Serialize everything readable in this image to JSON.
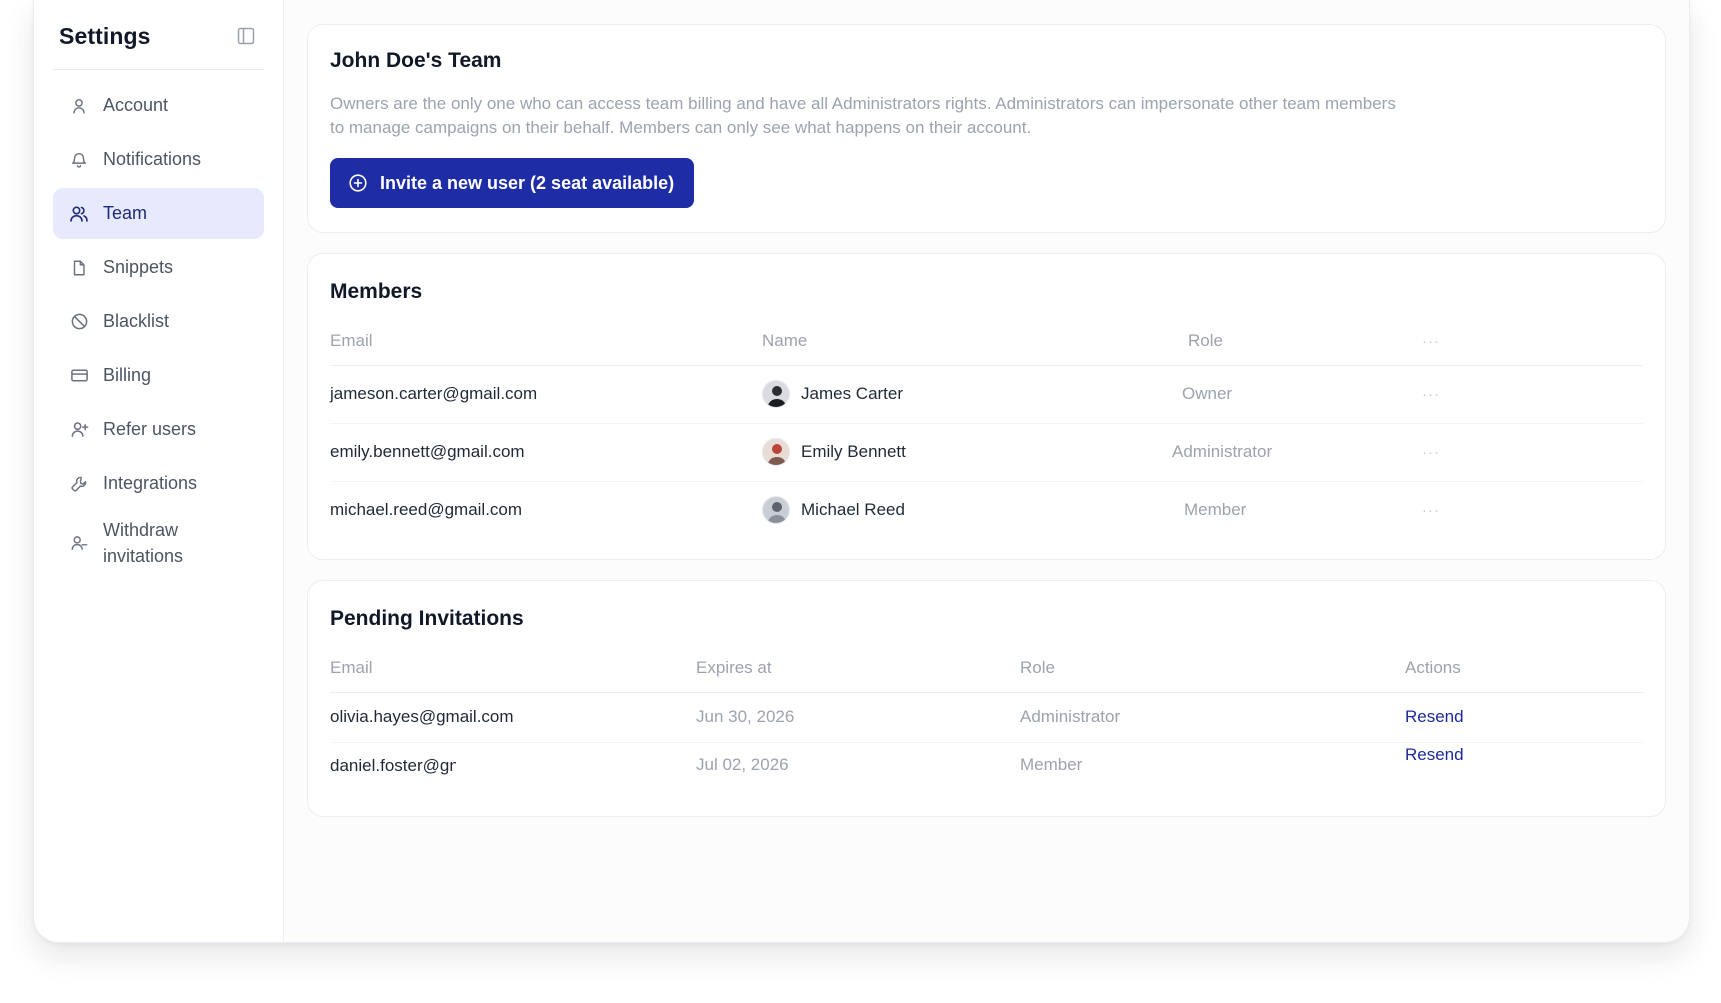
{
  "sidebar": {
    "title": "Settings",
    "items": [
      {
        "label": "Account",
        "icon": "user-icon"
      },
      {
        "label": "Notifications",
        "icon": "bell-icon"
      },
      {
        "label": "Team",
        "icon": "users-icon",
        "active": true
      },
      {
        "label": "Snippets",
        "icon": "file-icon"
      },
      {
        "label": "Blacklist",
        "icon": "ban-icon"
      },
      {
        "label": "Billing",
        "icon": "credit-card-icon"
      },
      {
        "label": "Refer users",
        "icon": "user-plus-icon"
      },
      {
        "label": "Integrations",
        "icon": "wrench-icon"
      },
      {
        "label": "Withdraw invitations",
        "icon": "user-minus-icon"
      }
    ]
  },
  "team": {
    "title": "John Doe's Team",
    "description": "Owners are the only one who can access team billing and have all Administrators rights. Administrators can impersonate other team members to manage campaigns on their behalf. Members can only see what happens on their account.",
    "invite_label": "Invite a new user (2 seat available)"
  },
  "members": {
    "title": "Members",
    "columns": {
      "email": "Email",
      "name": "Name",
      "role": "Role",
      "actions": "···"
    },
    "rows": [
      {
        "email": "jameson.carter@gmail.com",
        "name": "James Carter",
        "role": "Owner",
        "actions": "···"
      },
      {
        "email": "emily.bennett@gmail.com",
        "name": "Emily Bennett",
        "role": "Administrator",
        "actions": "···"
      },
      {
        "email": "michael.reed@gmail.com",
        "name": "Michael Reed",
        "role": "Member",
        "actions": "···"
      }
    ]
  },
  "pending": {
    "title": "Pending Invitations",
    "columns": {
      "email": "Email",
      "expires": "Expires at",
      "role": "Role",
      "actions": "Actions"
    },
    "rows": [
      {
        "email": "olivia.hayes@gmail.com",
        "expires": "Jun 30, 2026",
        "role": "Administrator",
        "action": "Resend"
      },
      {
        "email": "daniel.foster@gn",
        "expires": "Jul 02, 2026",
        "role": "Member",
        "action": "Resend"
      }
    ]
  },
  "colors": {
    "accent": "#1e2ca6",
    "active_bg": "#e6eafc",
    "muted_text": "#9ca3af"
  }
}
